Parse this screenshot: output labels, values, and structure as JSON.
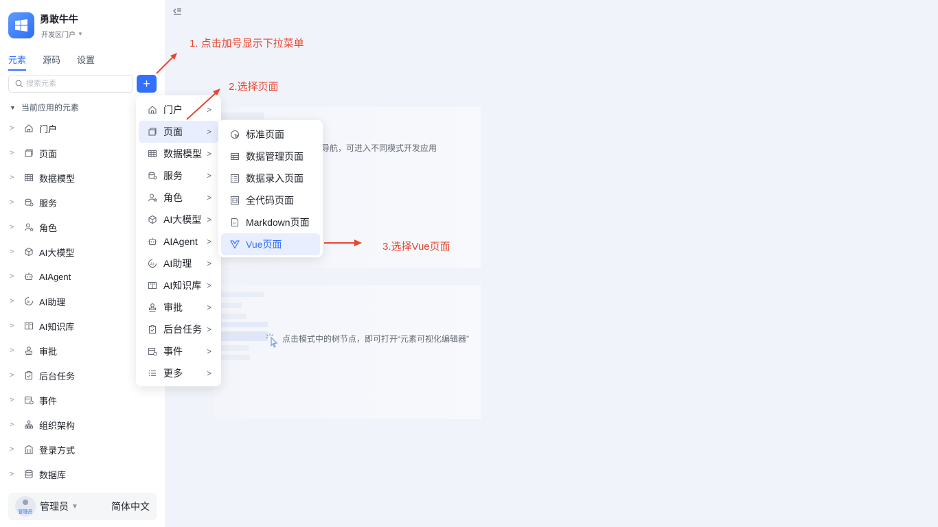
{
  "app": {
    "name": "勇敢牛牛",
    "subtitle": "开发区门户"
  },
  "tabs": [
    {
      "label": "元素"
    },
    {
      "label": "源码"
    },
    {
      "label": "设置"
    }
  ],
  "search": {
    "placeholder": "搜索元素"
  },
  "add_button": {
    "label": "+"
  },
  "section": {
    "title": "当前应用的元素"
  },
  "tree": [
    {
      "label": "门户",
      "icon": "home-icon"
    },
    {
      "label": "页面",
      "icon": "page-icon"
    },
    {
      "label": "数据模型",
      "icon": "table-icon"
    },
    {
      "label": "服务",
      "icon": "database-icon"
    },
    {
      "label": "角色",
      "icon": "role-icon"
    },
    {
      "label": "AI大模型",
      "icon": "cube-icon"
    },
    {
      "label": "AIAgent",
      "icon": "robot-icon"
    },
    {
      "label": "AI助理",
      "icon": "ai-icon"
    },
    {
      "label": "AI知识库",
      "icon": "book-icon"
    },
    {
      "label": "审批",
      "icon": "stamp-icon"
    },
    {
      "label": "后台任务",
      "icon": "task-icon"
    },
    {
      "label": "事件",
      "icon": "event-icon"
    },
    {
      "label": "组织架构",
      "icon": "org-icon"
    },
    {
      "label": "登录方式",
      "icon": "login-icon"
    },
    {
      "label": "数据库",
      "icon": "db-icon"
    }
  ],
  "user": {
    "name": "管理员",
    "avatar_label": "管理员",
    "language": "简体中文"
  },
  "menu": [
    {
      "label": "门户",
      "icon": "home-icon"
    },
    {
      "label": "页面",
      "icon": "page-icon"
    },
    {
      "label": "数据模型",
      "icon": "table-icon"
    },
    {
      "label": "服务",
      "icon": "database-icon"
    },
    {
      "label": "角色",
      "icon": "role-icon"
    },
    {
      "label": "AI大模型",
      "icon": "cube-icon"
    },
    {
      "label": "AIAgent",
      "icon": "robot-icon"
    },
    {
      "label": "AI助理",
      "icon": "ai-icon"
    },
    {
      "label": "AI知识库",
      "icon": "book-icon"
    },
    {
      "label": "审批",
      "icon": "stamp-icon"
    },
    {
      "label": "后台任务",
      "icon": "task-icon"
    },
    {
      "label": "事件",
      "icon": "event-icon"
    },
    {
      "label": "更多",
      "icon": "list-icon"
    }
  ],
  "submenu": [
    {
      "label": "标准页面",
      "icon": "standard-page-icon"
    },
    {
      "label": "数据管理页面",
      "icon": "table-icon"
    },
    {
      "label": "数据录入页面",
      "icon": "form-icon"
    },
    {
      "label": "全代码页面",
      "icon": "code-icon"
    },
    {
      "label": "Markdown页面",
      "icon": "markdown-icon"
    },
    {
      "label": "Vue页面",
      "icon": "vue-icon"
    }
  ],
  "hints": {
    "card1": "侧导航，可进入不同模式开发应用",
    "card2": "点击模式中的树节点，即可打开“元素可视化编辑器”"
  },
  "annotations": {
    "step1": "1. 点击加号显示下拉菜单",
    "step2": "2.选择页面",
    "step3": "3.选择Vue页面"
  },
  "colors": {
    "accent": "#3370ff",
    "annotation": "#e8452f"
  }
}
